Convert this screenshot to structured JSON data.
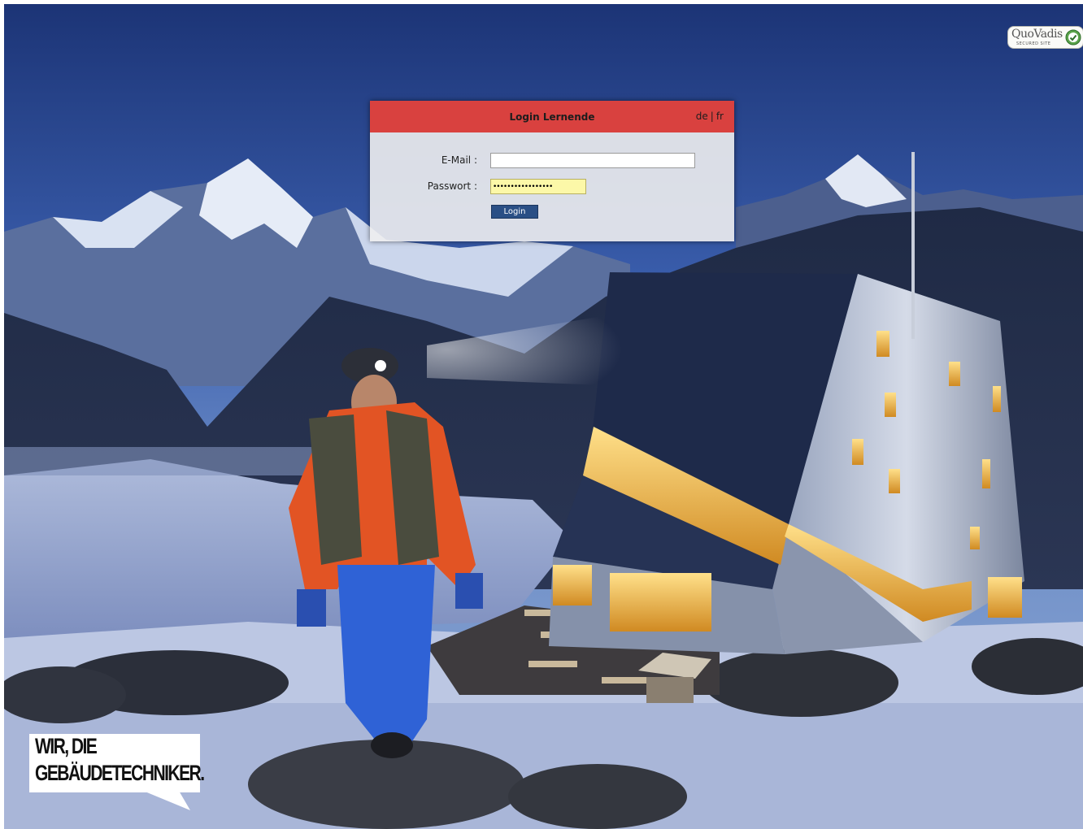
{
  "login": {
    "title": "Login Lernende",
    "lang_de": "de",
    "lang_separator": "|",
    "lang_fr": "fr",
    "email_label": "E-Mail :",
    "email_value": "",
    "password_label": "Passwort :",
    "password_value": "•••••••••••••••••",
    "button_label": "Login"
  },
  "badge": {
    "name": "QuoVadis",
    "subtitle": "SECURED SITE"
  },
  "slogan": {
    "line1": "WIR, DIE",
    "line2": "GEBÄUDETECHNIKER."
  },
  "colors": {
    "header_red": "#d9413f",
    "button_blue": "#2a4f85",
    "password_fill": "#fcf8a8"
  }
}
